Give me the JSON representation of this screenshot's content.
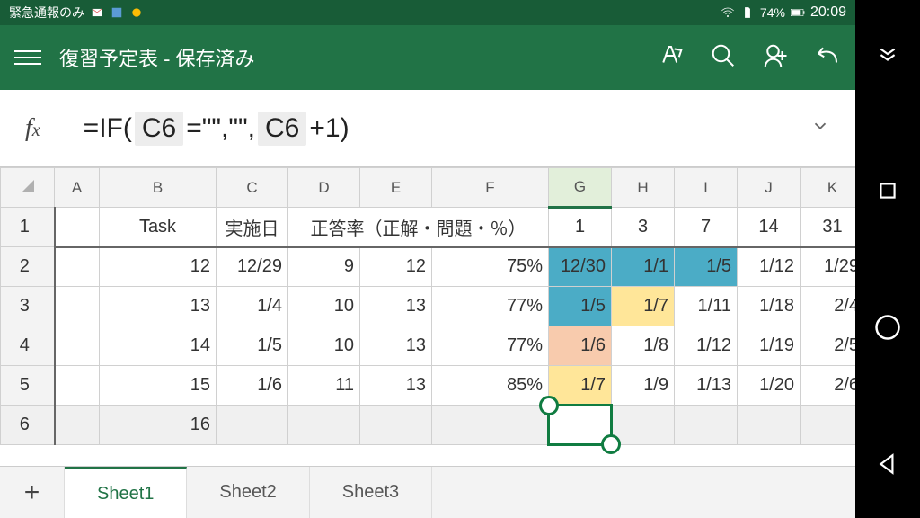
{
  "status": {
    "carrier": "緊急通報のみ",
    "battery_pct": "74%",
    "clock": "20:09"
  },
  "app": {
    "title": "復習予定表 - 保存済み"
  },
  "formula": {
    "prefix": "=IF(",
    "ref1": "C6",
    "mid1": " =\"\",\"\", ",
    "ref2": "C6",
    "mid2": " +1)"
  },
  "columns": [
    "A",
    "B",
    "C",
    "D",
    "E",
    "F",
    "G",
    "H",
    "I",
    "J",
    "K"
  ],
  "header_row": {
    "B": "Task",
    "C": "実施日",
    "DEF": "正答率（正解・問題・％）",
    "G": "1",
    "H": "3",
    "I": "7",
    "J": "14",
    "K": "31"
  },
  "rows": [
    {
      "n": "2",
      "B": "12",
      "C": "12/29",
      "D": "9",
      "E": "12",
      "F": "75%",
      "G": "12/30",
      "H": "1/1",
      "I": "1/5",
      "J": "1/12",
      "K": "1/29",
      "hl": {
        "G": "teal",
        "H": "teal",
        "I": "teal"
      }
    },
    {
      "n": "3",
      "B": "13",
      "C": "1/4",
      "D": "10",
      "E": "13",
      "F": "77%",
      "G": "1/5",
      "H": "1/7",
      "I": "1/11",
      "J": "1/18",
      "K": "2/4",
      "hl": {
        "G": "teal",
        "H": "yellow"
      }
    },
    {
      "n": "4",
      "B": "14",
      "C": "1/5",
      "D": "10",
      "E": "13",
      "F": "77%",
      "G": "1/6",
      "H": "1/8",
      "I": "1/12",
      "J": "1/19",
      "K": "2/5",
      "hl": {
        "G": "pink"
      }
    },
    {
      "n": "5",
      "B": "15",
      "C": "1/6",
      "D": "11",
      "E": "13",
      "F": "85%",
      "G": "1/7",
      "H": "1/9",
      "I": "1/13",
      "J": "1/20",
      "K": "2/6",
      "hl": {
        "G": "yellow"
      }
    },
    {
      "n": "6",
      "B": "16",
      "C": "",
      "D": "",
      "E": "",
      "F": "",
      "G": "",
      "H": "",
      "I": "",
      "J": "",
      "K": "",
      "hl": {}
    }
  ],
  "selected_cell": "G6",
  "tabs": [
    "Sheet1",
    "Sheet2",
    "Sheet3"
  ],
  "active_tab": 0
}
